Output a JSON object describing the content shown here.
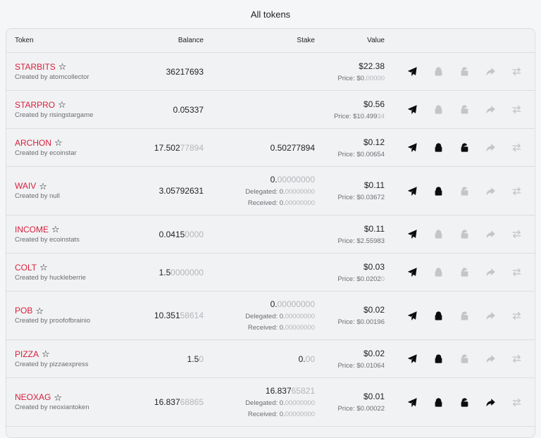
{
  "page": {
    "title": "All tokens"
  },
  "headers": {
    "token": "Token",
    "balance": "Balance",
    "stake": "Stake",
    "value": "Value"
  },
  "labels": {
    "delegated": "Delegated: ",
    "received": "Received: ",
    "price": "Price: "
  },
  "rows": [
    {
      "name": "STARBITS",
      "creator": "Created by atomcollector",
      "balance_main": "36217693",
      "balance_dim": "",
      "stake": null,
      "value": "$22.38",
      "price_main": "$0.",
      "price_dim": "00000",
      "actions": {
        "send": true,
        "stake": false,
        "unstake": false,
        "delegate": false,
        "swap": false
      }
    },
    {
      "name": "STARPRO",
      "creator": "Created by risingstargame",
      "balance_main": "0.05337",
      "balance_dim": "",
      "stake": null,
      "value": "$0.56",
      "price_main": "$10.499",
      "price_dim": "34",
      "actions": {
        "send": true,
        "stake": false,
        "unstake": false,
        "delegate": false,
        "swap": false
      }
    },
    {
      "name": "ARCHON",
      "creator": "Created by ecoinstar",
      "balance_main": "17.502",
      "balance_dim": "77894",
      "stake": {
        "main": "0.50277894",
        "dim": ""
      },
      "value": "$0.12",
      "price_main": "$0.00654",
      "price_dim": "",
      "actions": {
        "send": true,
        "stake": true,
        "unstake": true,
        "delegate": false,
        "swap": false
      }
    },
    {
      "name": "WAIV",
      "creator": "Created by null",
      "balance_main": "3.05792631",
      "balance_dim": "",
      "stake": {
        "main": "0.",
        "dim": "00000000",
        "delegated_main": "0.",
        "delegated_dim": "00000000",
        "received_main": "0.",
        "received_dim": "00000000"
      },
      "value": "$0.11",
      "price_main": "$0.03672",
      "price_dim": "",
      "actions": {
        "send": true,
        "stake": true,
        "unstake": false,
        "delegate": false,
        "swap": false
      }
    },
    {
      "name": "INCOME",
      "creator": "Created by ecoinstats",
      "balance_main": "0.0415",
      "balance_dim": "0000",
      "stake": null,
      "value": "$0.11",
      "price_main": "$2.55983",
      "price_dim": "",
      "actions": {
        "send": true,
        "stake": false,
        "unstake": false,
        "delegate": false,
        "swap": false
      }
    },
    {
      "name": "COLT",
      "creator": "Created by huckleberrie",
      "balance_main": "1.5",
      "balance_dim": "0000000",
      "stake": null,
      "value": "$0.03",
      "price_main": "$0.0202",
      "price_dim": "0",
      "actions": {
        "send": true,
        "stake": false,
        "unstake": false,
        "delegate": false,
        "swap": false
      }
    },
    {
      "name": "POB",
      "creator": "Created by proofofbrainio",
      "balance_main": "10.351",
      "balance_dim": "58614",
      "stake": {
        "main": "0.",
        "dim": "00000000",
        "delegated_main": "0.",
        "delegated_dim": "00000000",
        "received_main": "0.",
        "received_dim": "00000000"
      },
      "value": "$0.02",
      "price_main": "$0.00196",
      "price_dim": "",
      "actions": {
        "send": true,
        "stake": true,
        "unstake": false,
        "delegate": false,
        "swap": false
      }
    },
    {
      "name": "PIZZA",
      "creator": "Created by pizzaexpress",
      "balance_main": "1.5",
      "balance_dim": "0",
      "stake": {
        "main": "0.",
        "dim": "00"
      },
      "value": "$0.02",
      "price_main": "$0.01064",
      "price_dim": "",
      "actions": {
        "send": true,
        "stake": true,
        "unstake": false,
        "delegate": false,
        "swap": false
      }
    },
    {
      "name": "NEOXAG",
      "creator": "Created by neoxiantoken",
      "balance_main": "16.837",
      "balance_dim": "68865",
      "stake": {
        "main": "16.837",
        "dim": "65821",
        "delegated_main": "0.",
        "delegated_dim": "00000000",
        "received_main": "0.",
        "received_dim": "00000000"
      },
      "value": "$0.01",
      "price_main": "$0.00022",
      "price_dim": "",
      "actions": {
        "send": true,
        "stake": true,
        "unstake": true,
        "delegate": true,
        "swap": false
      }
    }
  ]
}
